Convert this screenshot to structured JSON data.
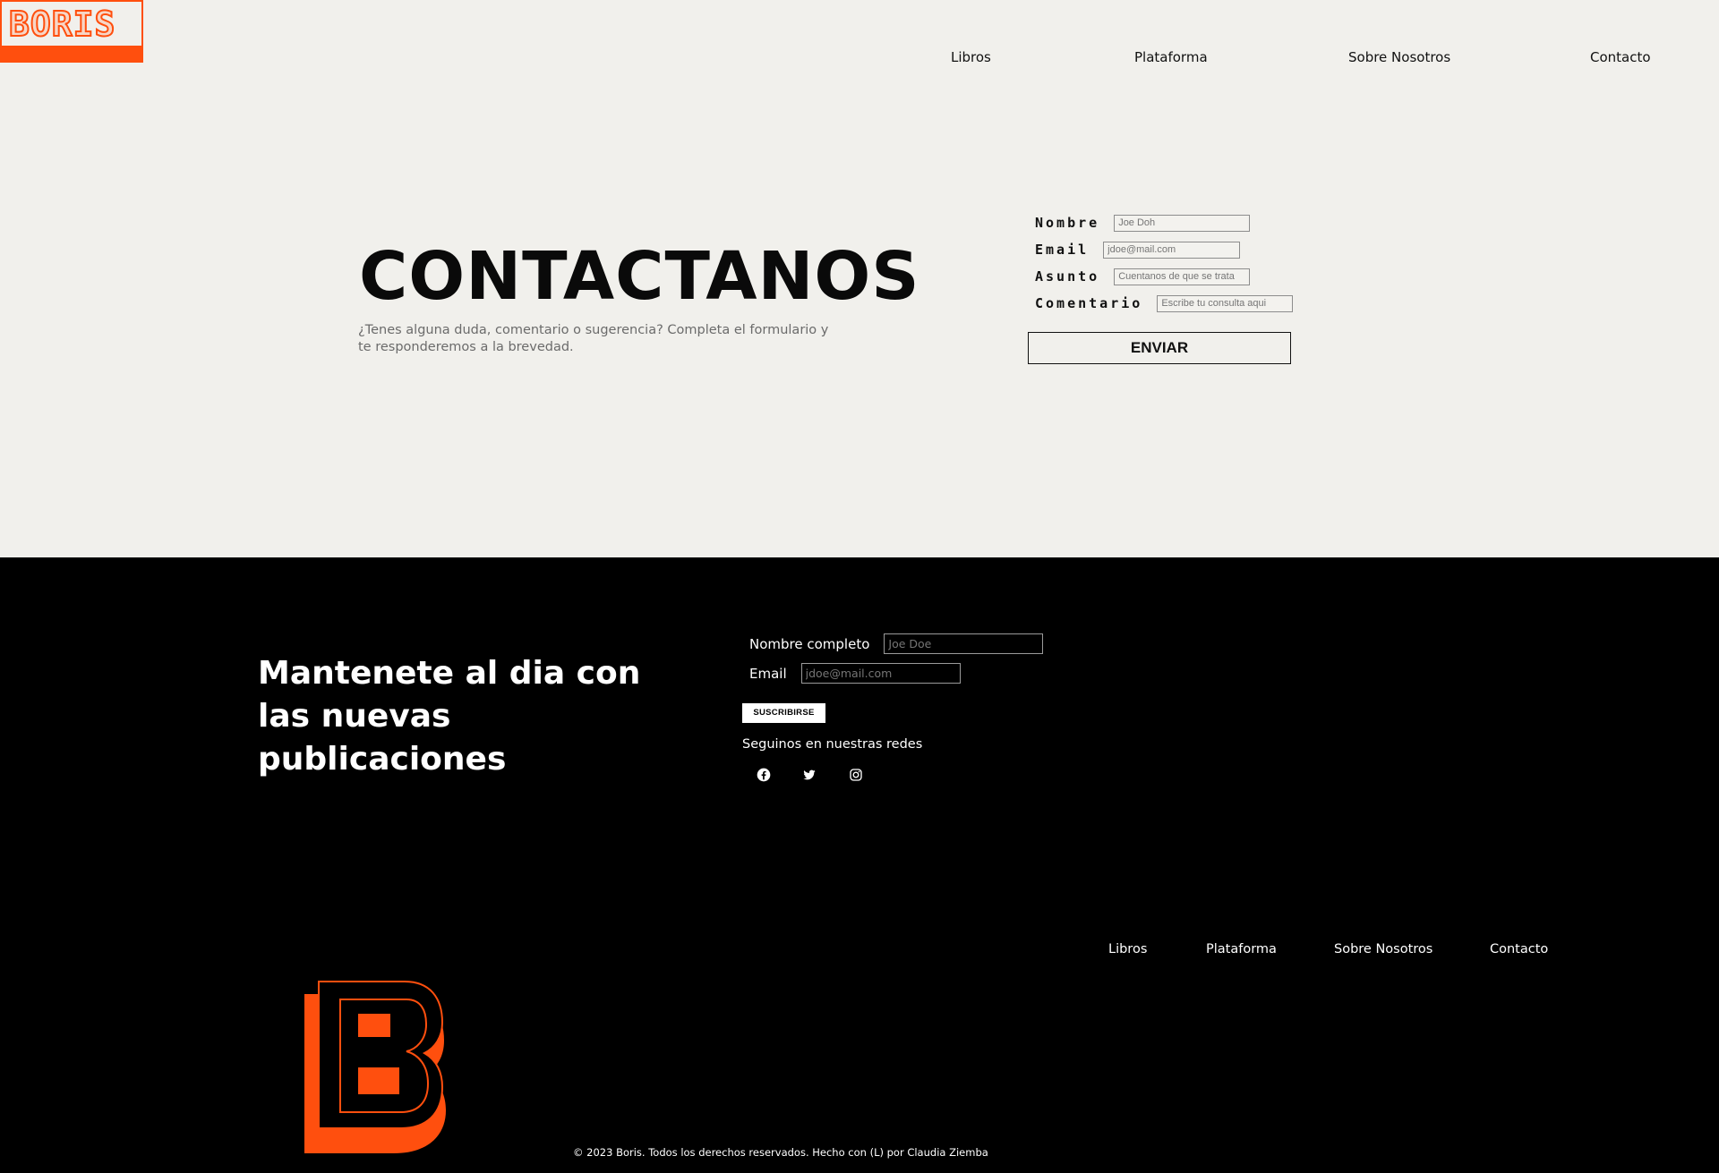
{
  "brand": {
    "logo_text": "BORIS"
  },
  "nav": {
    "items": [
      "Libros",
      "Plataforma",
      "Sobre Nosotros",
      "Contacto"
    ]
  },
  "hero": {
    "title": "CONTACTANOS",
    "subtitle": "¿Tenes alguna duda, comentario o sugerencia? Completa el formulario y te responderemos a la brevedad."
  },
  "contact_form": {
    "fields": [
      {
        "label": "Nombre",
        "placeholder": "Joe Doh"
      },
      {
        "label": "Email",
        "placeholder": "jdoe@mail.com"
      },
      {
        "label": "Asunto",
        "placeholder": "Cuentanos de que se trata"
      },
      {
        "label": "Comentario",
        "placeholder": "Escribe tu consulta aqui"
      }
    ],
    "submit_label": "ENVIAR"
  },
  "footer": {
    "heading": "Mantenete al dia con las nuevas publicaciones",
    "newsletter": {
      "name_label": "Nombre completo",
      "name_placeholder": "Joe Doe",
      "email_label": "Email",
      "email_placeholder": "jdoe@mail.com",
      "submit_label": "SUSCRIBIRSE"
    },
    "social_title": "Seguinos en nuestras redes",
    "social_icons": [
      "facebook-icon",
      "twitter-icon",
      "instagram-icon"
    ],
    "nav": [
      "Libros",
      "Plataforma",
      "Sobre Nosotros",
      "Contacto"
    ],
    "copyright": "© 2023 Boris. Todos los derechos reservados. Hecho con (L) por Claudia Ziemba"
  },
  "colors": {
    "accent": "#ff4f0e",
    "background": "#f1f0ec",
    "footer_bg": "#000000"
  }
}
